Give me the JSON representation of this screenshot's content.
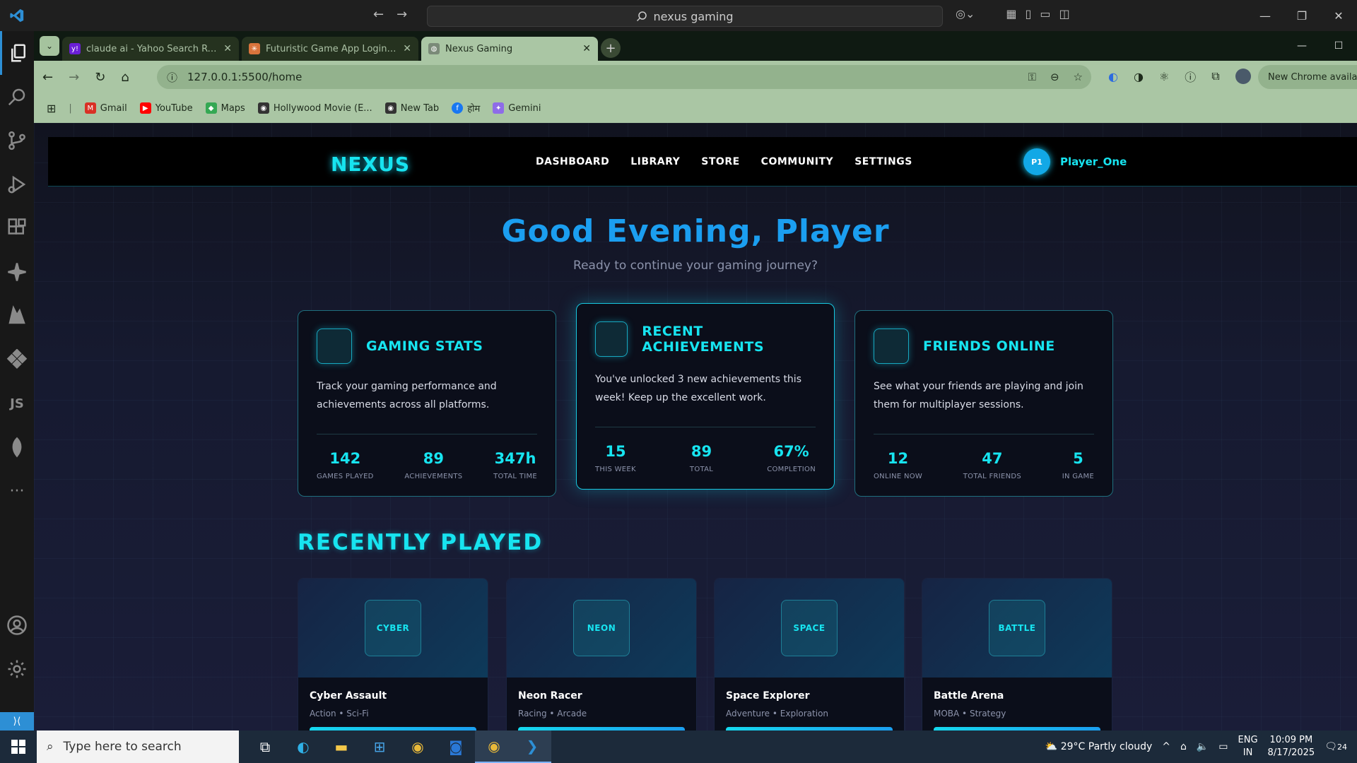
{
  "vscode": {
    "search_text": "nexus gaming"
  },
  "browser": {
    "tabs": [
      {
        "title": "claude ai - Yahoo Search Results",
        "fav_color": "#6a1fd6",
        "fav_text": "y!"
      },
      {
        "title": "Futuristic Game App Login Des",
        "fav_color": "#d9743c",
        "fav_text": "✳"
      },
      {
        "title": "Nexus Gaming",
        "fav_color": "#7a8a78",
        "fav_text": "◍"
      }
    ],
    "url": "127.0.0.1:5500/home",
    "new_chrome": "New Chrome available",
    "bookmarks": [
      {
        "label": "Gmail",
        "color": "#d93025",
        "glyph": "M"
      },
      {
        "label": "YouTube",
        "color": "#ff0000",
        "glyph": "▶"
      },
      {
        "label": "Maps",
        "color": "#34a853",
        "glyph": "◆"
      },
      {
        "label": "Hollywood Movie (E...",
        "color": "#333333",
        "glyph": "◉"
      },
      {
        "label": "New Tab",
        "color": "#333333",
        "glyph": "◉"
      },
      {
        "label": "होम",
        "color": "#1877f2",
        "glyph": "f"
      },
      {
        "label": "Gemini",
        "color": "#8e6ce8",
        "glyph": "✦"
      }
    ]
  },
  "site": {
    "logo": "NEXUS",
    "nav": [
      "DASHBOARD",
      "LIBRARY",
      "STORE",
      "COMMUNITY",
      "SETTINGS"
    ],
    "user": {
      "initials": "P1",
      "name": "Player_One"
    },
    "greeting": "Good Evening, Player",
    "subtitle": "Ready to continue your gaming journey?",
    "cards": [
      {
        "title": "GAMING STATS",
        "desc": "Track your gaming performance and achievements across all platforms.",
        "stats": [
          {
            "value": "142",
            "label": "GAMES PLAYED"
          },
          {
            "value": "89",
            "label": "ACHIEVEMENTS"
          },
          {
            "value": "347h",
            "label": "TOTAL TIME"
          }
        ]
      },
      {
        "title": "RECENT ACHIEVEMENTS",
        "desc": "You've unlocked 3 new achievements this week! Keep up the excellent work.",
        "stats": [
          {
            "value": "15",
            "label": "THIS WEEK"
          },
          {
            "value": "89",
            "label": "TOTAL"
          },
          {
            "value": "67%",
            "label": "COMPLETION"
          }
        ]
      },
      {
        "title": "FRIENDS ONLINE",
        "desc": "See what your friends are playing and join them for multiplayer sessions.",
        "stats": [
          {
            "value": "12",
            "label": "ONLINE NOW"
          },
          {
            "value": "47",
            "label": "TOTAL FRIENDS"
          },
          {
            "value": "5",
            "label": "IN GAME"
          }
        ]
      }
    ],
    "recent_title": "RECENTLY PLAYED",
    "games": [
      {
        "tag": "CYBER",
        "name": "Cyber Assault",
        "genre": "Action • Sci-Fi"
      },
      {
        "tag": "NEON",
        "name": "Neon Racer",
        "genre": "Racing • Arcade"
      },
      {
        "tag": "SPACE",
        "name": "Space Explorer",
        "genre": "Adventure • Exploration"
      },
      {
        "tag": "BATTLE",
        "name": "Battle Arena",
        "genre": "MOBA • Strategy"
      }
    ]
  },
  "taskbar": {
    "search_placeholder": "Type here to search",
    "weather": "29°C  Partly cloudy",
    "lang1": "ENG",
    "lang2": "IN",
    "time": "10:09 PM",
    "date": "8/17/2025",
    "notif_count": "24"
  }
}
